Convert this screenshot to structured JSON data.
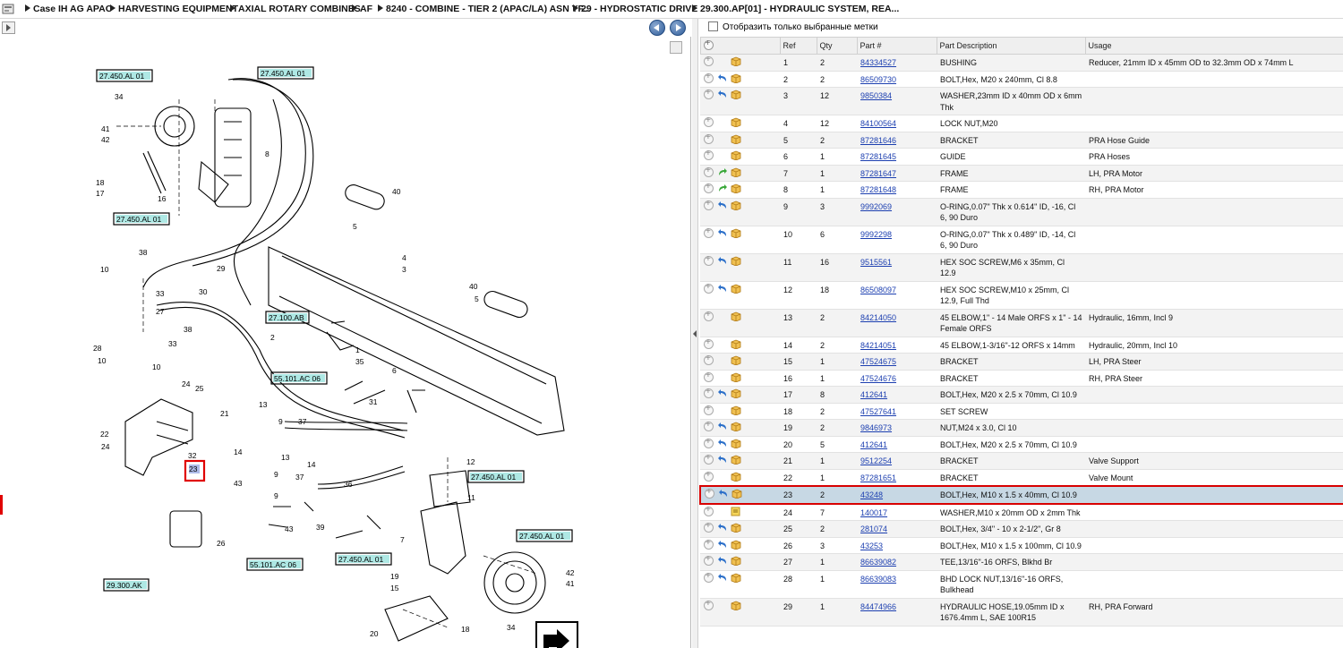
{
  "breadcrumb": [
    "Case IH AG APAC",
    "HARVESTING EQUIPMENT",
    "AXIAL ROTARY COMBINES",
    "AF",
    "8240 - COMBINE - TIER 2 (APAC/LA) ASN YF...",
    "29 - HYDROSTATIC DRIVE",
    "29.300.AP[01] - HYDRAULIC SYSTEM, REA..."
  ],
  "filter": {
    "label": "Отобразить только выбранные метки",
    "checked": false
  },
  "columns": [
    "Ref",
    "Qty",
    "Part #",
    "Part Description",
    "Usage"
  ],
  "parts": [
    {
      "ref": "1",
      "qty": "2",
      "part": "84334527",
      "desc": "BUSHING",
      "usage": "Reducer, 21mm ID x 45mm OD to 32.3mm OD x 74mm L",
      "sub": false
    },
    {
      "ref": "2",
      "qty": "2",
      "part": "86509730",
      "desc": "BOLT,Hex, M20 x 240mm, Cl 8.8",
      "usage": "",
      "sub": true
    },
    {
      "ref": "3",
      "qty": "12",
      "part": "9850384",
      "desc": "WASHER,23mm ID x 40mm OD x 6mm Thk",
      "usage": "",
      "sub": true
    },
    {
      "ref": "4",
      "qty": "12",
      "part": "84100564",
      "desc": "LOCK NUT,M20",
      "usage": "",
      "sub": false
    },
    {
      "ref": "5",
      "qty": "2",
      "part": "87281646",
      "desc": "BRACKET",
      "usage": "PRA Hose Guide",
      "sub": false
    },
    {
      "ref": "6",
      "qty": "1",
      "part": "87281645",
      "desc": "GUIDE",
      "usage": "PRA Hoses",
      "sub": false
    },
    {
      "ref": "7",
      "qty": "1",
      "part": "87281647",
      "desc": "FRAME",
      "usage": "LH, PRA Motor",
      "sub": "green"
    },
    {
      "ref": "8",
      "qty": "1",
      "part": "87281648",
      "desc": "FRAME",
      "usage": "RH, PRA Motor",
      "sub": "green"
    },
    {
      "ref": "9",
      "qty": "3",
      "part": "9992069",
      "desc": "O-RING,0.07\" Thk x 0.614\" ID, -16, Cl 6, 90 Duro",
      "usage": "",
      "sub": true
    },
    {
      "ref": "10",
      "qty": "6",
      "part": "9992298",
      "desc": "O-RING,0.07\" Thk x 0.489\" ID, -14, Cl 6, 90 Duro",
      "usage": "",
      "sub": true
    },
    {
      "ref": "11",
      "qty": "16",
      "part": "9515561",
      "desc": "HEX SOC SCREW,M6 x 35mm, Cl 12.9",
      "usage": "",
      "sub": true
    },
    {
      "ref": "12",
      "qty": "18",
      "part": "86508097",
      "desc": "HEX SOC SCREW,M10 x 25mm, Cl 12.9, Full Thd",
      "usage": "",
      "sub": true
    },
    {
      "ref": "13",
      "qty": "2",
      "part": "84214050",
      "desc": "45 ELBOW,1\" - 14 Male ORFS x 1\" - 14 Female ORFS",
      "usage": "Hydraulic, 16mm, Incl 9",
      "sub": false
    },
    {
      "ref": "14",
      "qty": "2",
      "part": "84214051",
      "desc": "45 ELBOW,1-3/16\"-12 ORFS x 14mm",
      "usage": "Hydraulic, 20mm, Incl 10",
      "sub": false
    },
    {
      "ref": "15",
      "qty": "1",
      "part": "47524675",
      "desc": "BRACKET",
      "usage": "LH, PRA Steer",
      "sub": false
    },
    {
      "ref": "16",
      "qty": "1",
      "part": "47524676",
      "desc": "BRACKET",
      "usage": "RH, PRA Steer",
      "sub": false
    },
    {
      "ref": "17",
      "qty": "8",
      "part": "412641",
      "desc": "BOLT,Hex, M20 x 2.5 x 70mm, Cl 10.9",
      "usage": "",
      "sub": true
    },
    {
      "ref": "18",
      "qty": "2",
      "part": "47527641",
      "desc": "SET SCREW",
      "usage": "",
      "sub": false
    },
    {
      "ref": "19",
      "qty": "2",
      "part": "9846973",
      "desc": "NUT,M24 x 3.0, Cl 10",
      "usage": "",
      "sub": true
    },
    {
      "ref": "20",
      "qty": "5",
      "part": "412641",
      "desc": "BOLT,Hex, M20 x 2.5 x 70mm, Cl 10.9",
      "usage": "",
      "sub": true
    },
    {
      "ref": "21",
      "qty": "1",
      "part": "9512254",
      "desc": "BRACKET",
      "usage": "Valve Support",
      "sub": true
    },
    {
      "ref": "22",
      "qty": "1",
      "part": "87281651",
      "desc": "BRACKET",
      "usage": "Valve Mount",
      "sub": false
    },
    {
      "ref": "23",
      "qty": "2",
      "part": "43248",
      "desc": "BOLT,Hex, M10 x 1.5 x 40mm, Cl 10.9",
      "usage": "",
      "sub": true,
      "selected": true
    },
    {
      "ref": "24",
      "qty": "7",
      "part": "140017",
      "desc": "WASHER,M10 x 20mm OD x 2mm Thk",
      "usage": "",
      "sub": false,
      "note": true
    },
    {
      "ref": "25",
      "qty": "2",
      "part": "281074",
      "desc": "BOLT,Hex, 3/4\" - 10 x 2-1/2\", Gr 8",
      "usage": "",
      "sub": true
    },
    {
      "ref": "26",
      "qty": "3",
      "part": "43253",
      "desc": "BOLT,Hex, M10 x 1.5 x 100mm, Cl 10.9",
      "usage": "",
      "sub": true
    },
    {
      "ref": "27",
      "qty": "1",
      "part": "86639082",
      "desc": "TEE,13/16\"-16 ORFS, Blkhd Br",
      "usage": "",
      "sub": true
    },
    {
      "ref": "28",
      "qty": "1",
      "part": "86639083",
      "desc": "BHD LOCK NUT,13/16\"-16 ORFS, Bulkhead",
      "usage": "",
      "sub": true
    },
    {
      "ref": "29",
      "qty": "1",
      "part": "84474966",
      "desc": "HYDRAULIC HOSE,19.05mm ID x 1676.4mm L, SAE 100R15",
      "usage": "RH, PRA Forward",
      "sub": false
    }
  ],
  "diagram": {
    "boxes": [
      "27.450.AL 01",
      "27.450.AL 01",
      "27.450.AL 01",
      "27.100.AB",
      "55.101.AC 06",
      "27.450.AL 01",
      "27.450.AL 01",
      "27.450.AL 01",
      "55.101.AC 06",
      "29.300.AK"
    ],
    "callouts": [
      "34",
      "41",
      "42",
      "18",
      "17",
      "16",
      "8",
      "40",
      "5",
      "38",
      "10",
      "33",
      "27",
      "30",
      "29",
      "4",
      "3",
      "40",
      "5",
      "28",
      "10",
      "38",
      "33",
      "10",
      "2",
      "1",
      "35",
      "6",
      "31",
      "24",
      "25",
      "21",
      "22",
      "24",
      "32",
      "23",
      "13",
      "9",
      "37",
      "14",
      "43",
      "13",
      "9",
      "37",
      "12",
      "11",
      "14",
      "36",
      "9",
      "43",
      "39",
      "7",
      "26",
      "19",
      "15",
      "42",
      "41",
      "34",
      "20",
      "18"
    ]
  },
  "colors": {
    "accent": "#1c3fb0",
    "selected_row": "#c7d8e4",
    "highlight": "#d80000",
    "ref_box": "#aee8e4"
  }
}
